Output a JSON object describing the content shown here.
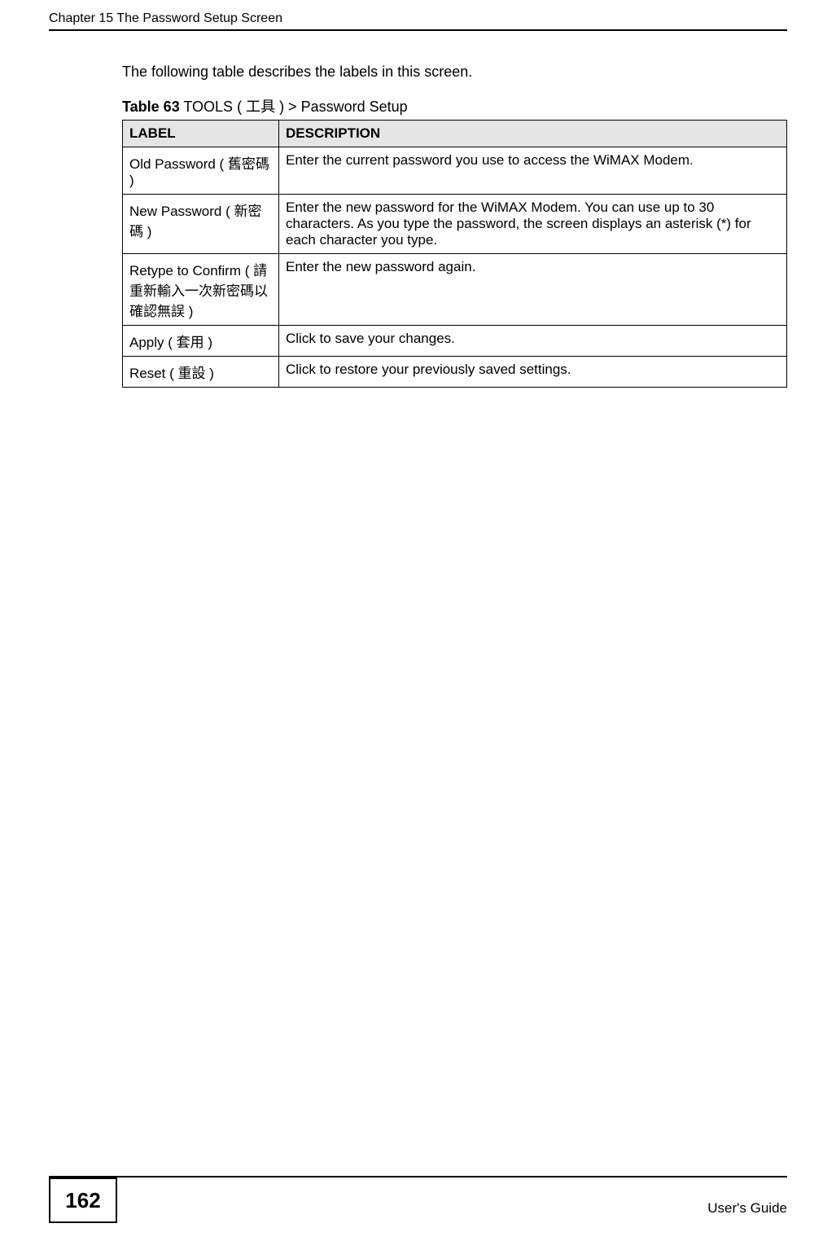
{
  "header": {
    "chapter": "Chapter 15 The Password Setup Screen"
  },
  "intro": "The following table describes the labels in this screen.",
  "table": {
    "num_label": "Table 63",
    "title_rest": "   TOOLS ( 工具 ) > Password Setup",
    "head_label": "LABEL",
    "head_desc": "DESCRIPTION",
    "rows": [
      {
        "label": "Old Password ( 舊密碼 )",
        "desc": "Enter the current password you use to access the WiMAX Modem."
      },
      {
        "label": "New Password ( 新密碼 )",
        "desc": "Enter the new password for the WiMAX Modem. You can use up to 30 characters. As you type the password, the screen displays an asterisk (*) for each character you type."
      },
      {
        "label": "Retype to Confirm ( 請重新輸入一次新密碼以確認無誤 )",
        "desc": "Enter the new password again."
      },
      {
        "label": "Apply ( 套用 )",
        "desc": "Click to save your changes."
      },
      {
        "label": "Reset ( 重設 )",
        "desc": "Click to restore your previously saved settings."
      }
    ]
  },
  "footer": {
    "page_number": "162",
    "guide": "User's Guide"
  }
}
